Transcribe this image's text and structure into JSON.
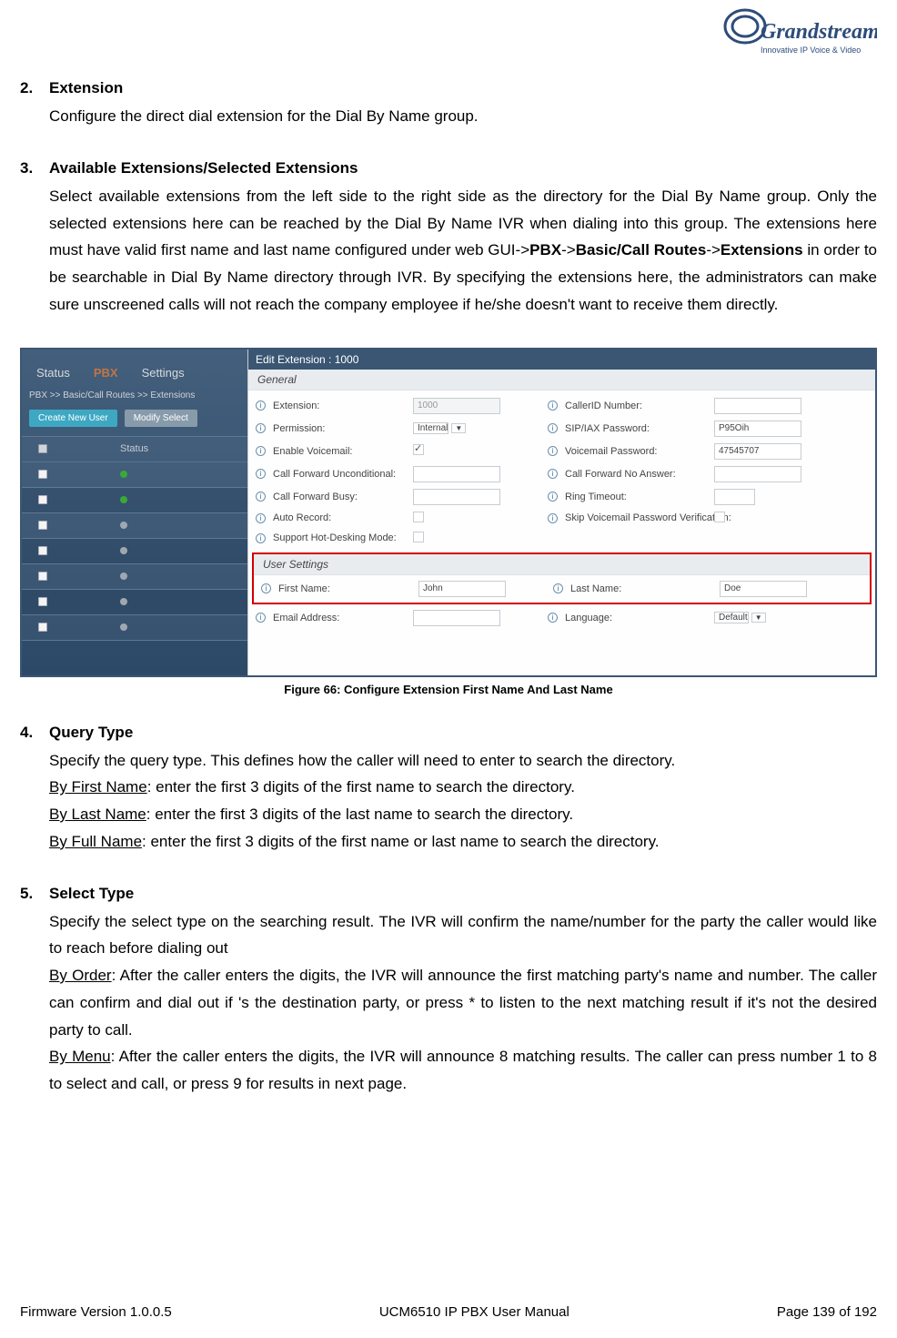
{
  "logo": {
    "brand": "Grandstream",
    "tagline": "Innovative IP Voice & Video"
  },
  "sections": {
    "s2": {
      "num": "2.",
      "title": "Extension",
      "body": "Configure the direct dial extension for the Dial By Name group."
    },
    "s3": {
      "num": "3.",
      "title": "Available Extensions/Selected Extensions",
      "body_pre": "Select available extensions from the left side to the right side as the directory for the Dial By Name group. Only the selected extensions here can be reached by the Dial By Name IVR when dialing into this group. The extensions here must have valid first name and last name configured under web GUI->",
      "b1": "PBX",
      "sep1": "->",
      "b2": "Basic/Call Routes",
      "sep2": "->",
      "b3": "Extensions",
      "body_post": " in order to be searchable in Dial By Name directory through IVR. By specifying the extensions here, the administrators can make sure unscreened calls will not reach the company employee if he/she doesn't want to receive them directly."
    },
    "s4": {
      "num": "4.",
      "title": "Query Type",
      "line1": "Specify the query type. This defines how the caller will need to enter to search the directory.",
      "u1": "By First Name",
      "u1r": ": enter the first 3 digits of the first name to search the directory.",
      "u2": "By Last Name",
      "u2r": ": enter the first 3 digits of the last name to search the directory.",
      "u3": "By Full Name",
      "u3r": ": enter the first 3 digits of the first name or last name to search the directory."
    },
    "s5": {
      "num": "5.",
      "title": "Select Type",
      "line1": "Specify the select type on the searching result. The IVR will confirm the name/number for the party the caller would like to reach before dialing out",
      "u1": "By Order",
      "u1r": ": After the caller enters the digits, the IVR will announce the first matching party's name and number. The caller can confirm and dial out if 's the destination party, or press * to listen to the next matching result if it's not the desired party to call.",
      "u2": "By Menu",
      "u2r": ": After the caller enters the digits, the IVR will announce 8 matching results. The caller can press number 1 to 8 to select and call, or press 9 for results in next page."
    }
  },
  "figure": {
    "caption": "Figure 66: Configure Extension First Name And Last Name"
  },
  "gui": {
    "left": {
      "tabs": {
        "status": "Status",
        "pbx": "PBX",
        "settings": "Settings"
      },
      "breadcrumb": "PBX >> Basic/Call Routes >> Extensions",
      "btn_create": "Create New User",
      "btn_modify": "Modify Select",
      "header": "Status"
    },
    "right": {
      "title": "Edit Extension : 1000",
      "section_general": "General",
      "section_user": "User Settings",
      "labels": {
        "extension": "Extension:",
        "callerid": "CallerID Number:",
        "permission": "Permission:",
        "sippwd": "SIP/IAX Password:",
        "envm": "Enable Voicemail:",
        "vmpwd": "Voicemail Password:",
        "cfu": "Call Forward Unconditional:",
        "cfna": "Call Forward No Answer:",
        "cfb": "Call Forward Busy:",
        "ring": "Ring Timeout:",
        "autorec": "Auto Record:",
        "skipvm": "Skip Voicemail Password Verification:",
        "hotdesk": "Support Hot-Desking Mode:",
        "fname": "First Name:",
        "lname": "Last Name:",
        "email": "Email Address:",
        "lang": "Language:"
      },
      "values": {
        "extension": "1000",
        "permission": "Internal",
        "sippwd": "P95Oih",
        "vmpwd": "47545707",
        "fname": "John",
        "lname": "Doe",
        "lang": "Default"
      }
    }
  },
  "footer": {
    "left": "Firmware Version 1.0.0.5",
    "center": "UCM6510 IP PBX User Manual",
    "right": "Page 139 of 192"
  }
}
